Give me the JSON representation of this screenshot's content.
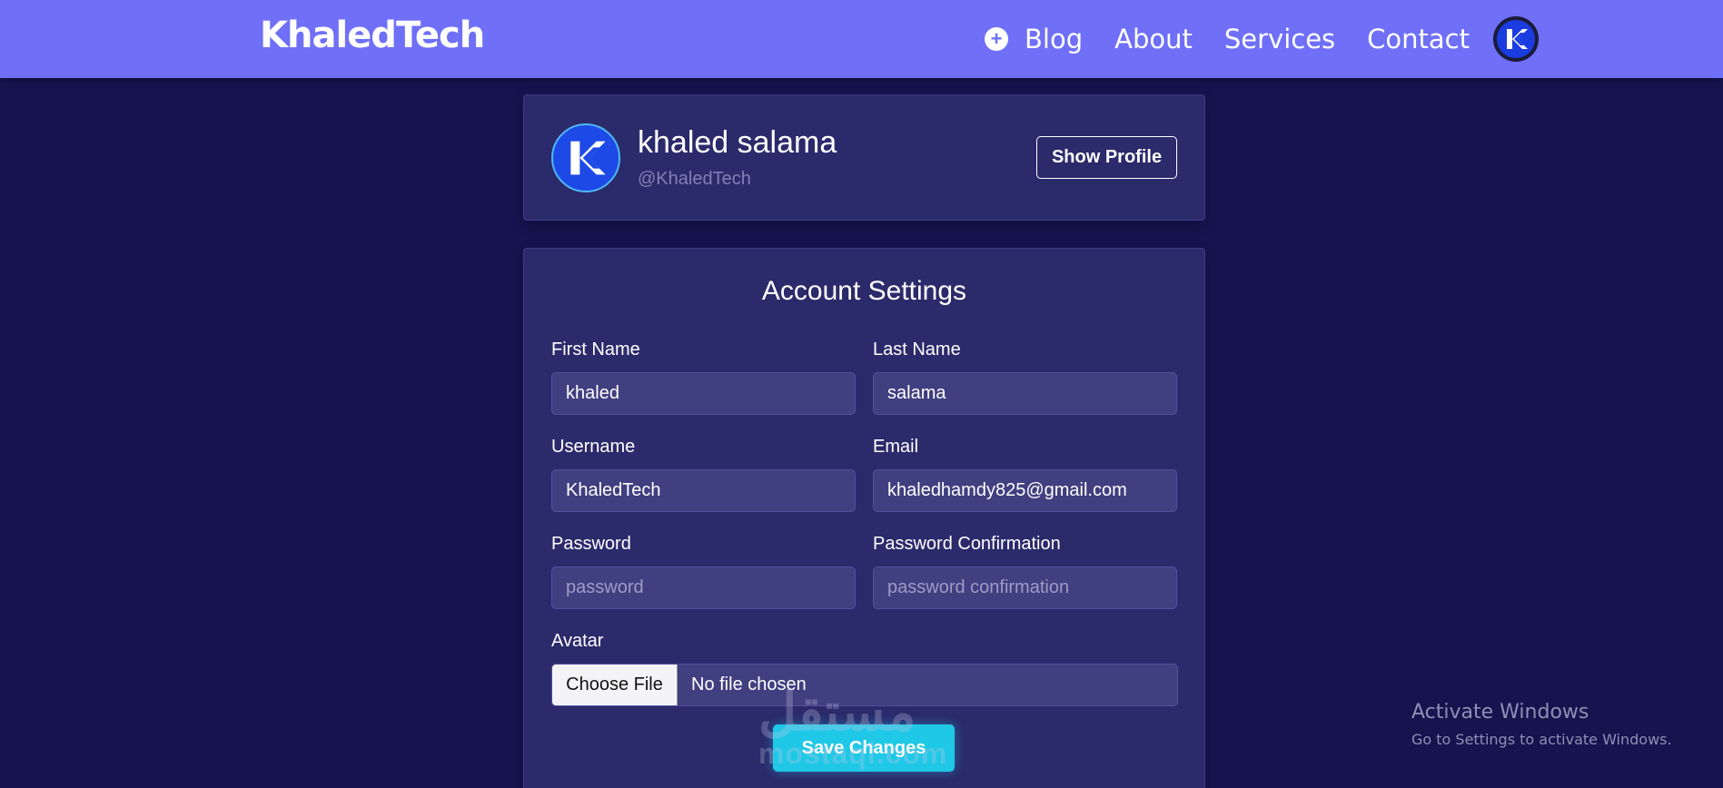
{
  "navbar": {
    "brand": "KhaledTech",
    "links": [
      "Blog",
      "About",
      "Services",
      "Contact"
    ],
    "plus_icon": "plus-circle-icon",
    "avatar_icon": "k-logo-icon",
    "bg_color": "#6f6ff7"
  },
  "profile": {
    "name": "khaled salama",
    "handle": "@KhaledTech",
    "show_profile_label": "Show Profile",
    "avatar_icon": "k-logo-icon"
  },
  "settings": {
    "title": "Account Settings",
    "fields": {
      "first_name": {
        "label": "First Name",
        "value": "khaled"
      },
      "last_name": {
        "label": "Last Name",
        "value": "salama"
      },
      "username": {
        "label": "Username",
        "value": "KhaledTech"
      },
      "email": {
        "label": "Email",
        "value": "khaledhamdy825@gmail.com"
      },
      "password": {
        "label": "Password",
        "placeholder": "password"
      },
      "password_confirmation": {
        "label": "Password Confirmation",
        "placeholder": "password confirmation"
      },
      "avatar": {
        "label": "Avatar",
        "button": "Choose File",
        "status": "No file chosen"
      }
    },
    "save_label": "Save Changes",
    "accent_color": "#1fc8e6"
  },
  "watermark": {
    "arabic": "مستقل",
    "latin": "mostaql.com"
  },
  "os_overlay": {
    "title": "Activate Windows",
    "subtitle": "Go to Settings to activate Windows."
  }
}
